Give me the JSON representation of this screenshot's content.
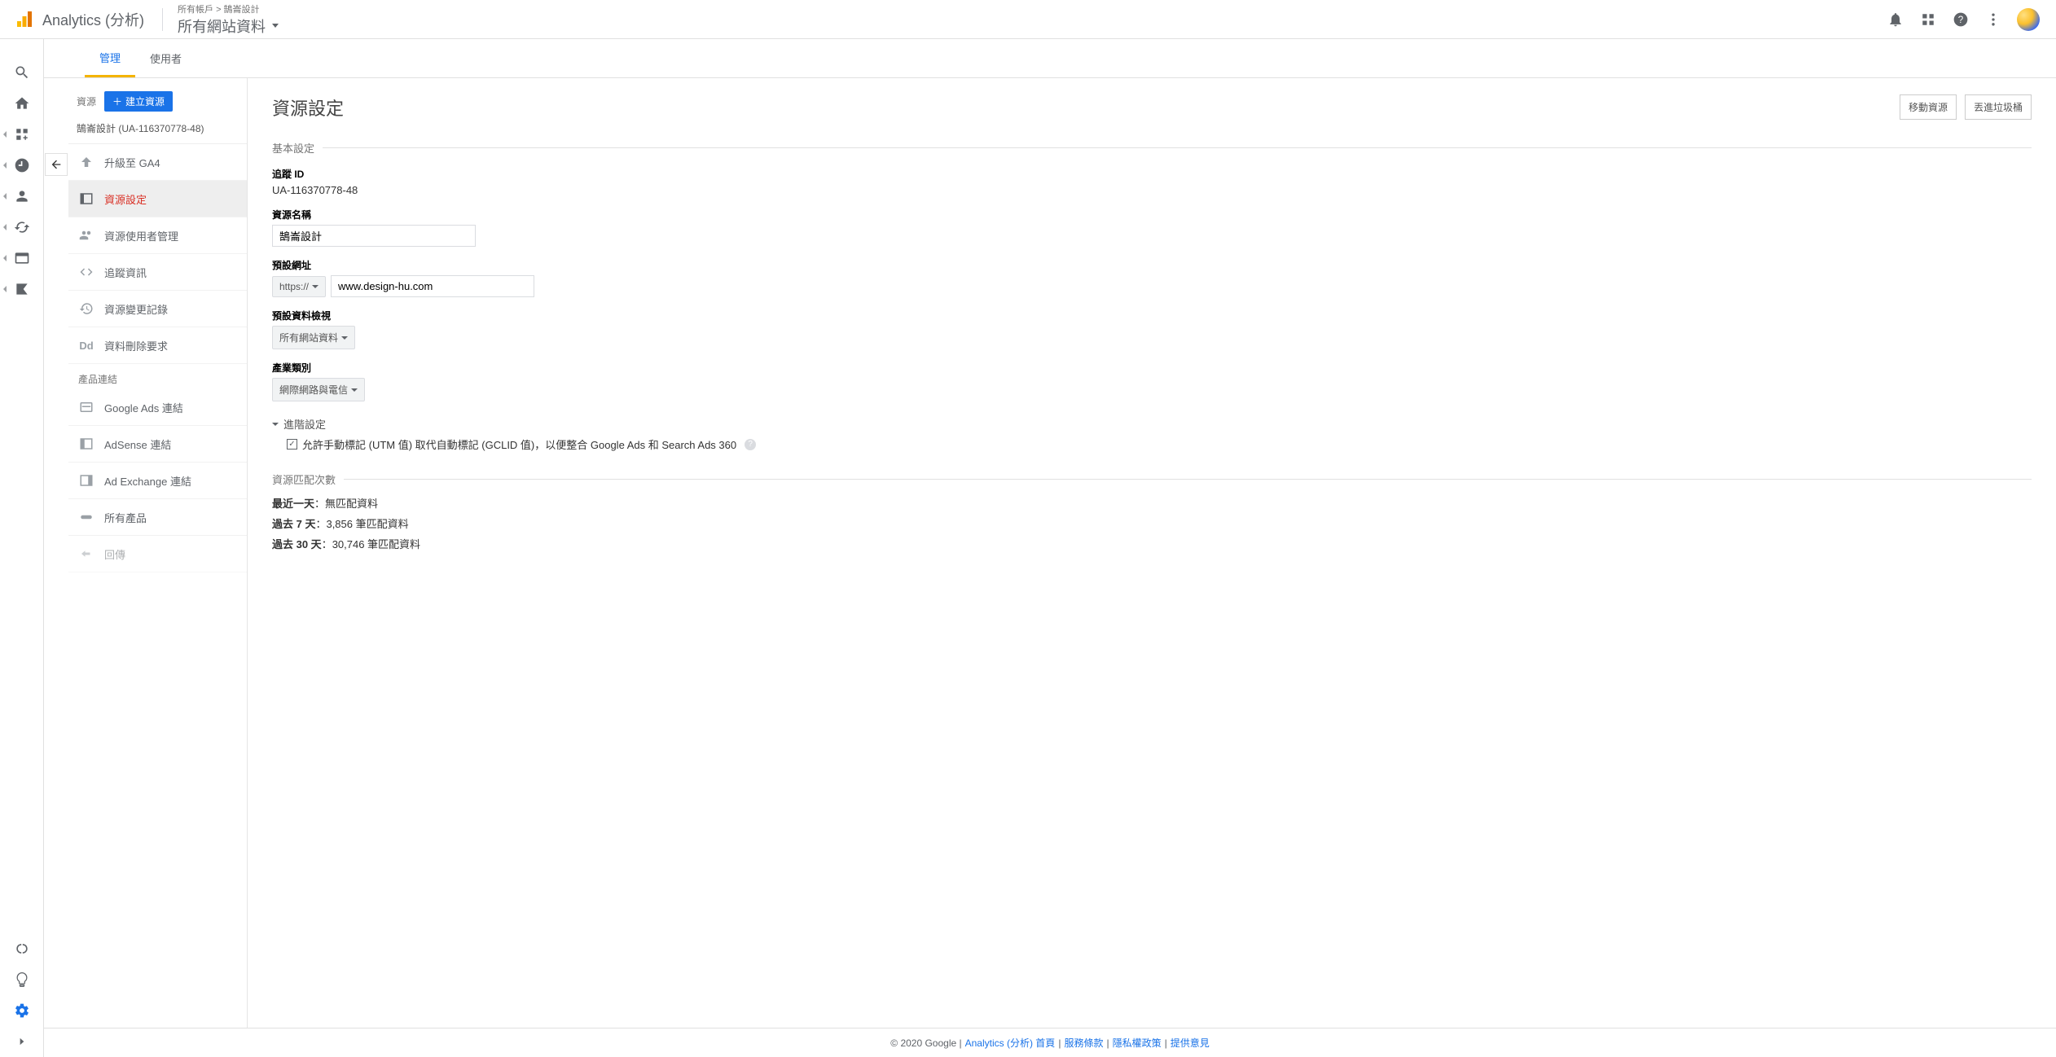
{
  "header": {
    "product": "Analytics (分析)",
    "crumb": "所有帳戶 > 鵠崙設計",
    "viewName": "所有網站資料"
  },
  "tabs": {
    "admin": "管理",
    "users": "使用者"
  },
  "midcol": {
    "label": "資源",
    "createBtn": "建立資源",
    "subtitle": "鵠崙設計 (UA-116370778-48)",
    "items": {
      "upgrade": "升級至 GA4",
      "settings": "資源設定",
      "usermgmt": "資源使用者管理",
      "tracking": "追蹤資訊",
      "changelog": "資源變更記錄",
      "deletereq": "資料刪除要求"
    },
    "groupLabel": "產品連結",
    "links": {
      "gads": "Google Ads 連結",
      "adsense": "AdSense 連結",
      "adx": "Ad Exchange 連結",
      "allproducts": "所有產品",
      "postback": "回傳"
    }
  },
  "form": {
    "title": "資源設定",
    "actions": {
      "move": "移動資源",
      "trash": "丟進垃圾桶"
    },
    "sectionBasic": "基本設定",
    "trackingIdLabel": "追蹤 ID",
    "trackingId": "UA-116370778-48",
    "nameLabel": "資源名稱",
    "nameValue": "鵠崙設計",
    "urlLabel": "預設網址",
    "urlProto": "https://",
    "urlValue": "www.design-hu.com",
    "defaultViewLabel": "預設資料檢視",
    "defaultView": "所有網站資料",
    "industryLabel": "產業類別",
    "industry": "網際網路與電信",
    "advLabel": "進階設定",
    "advCheck": "允許手動標記 (UTM 值) 取代自動標記 (GCLID 值)，以便整合 Google Ads 和 Search Ads 360",
    "hitsSection": "資源匹配次數",
    "hits1Label": "最近一天",
    "hits1Val": "：無匹配資料",
    "hits7Label": "過去 7 天",
    "hits7Val": "：3,856 筆匹配資料",
    "hits30Label": "過去 30 天",
    "hits30Val": "：30,746 筆匹配資料"
  },
  "footer": {
    "copy": "© 2020 Google | ",
    "home": "Analytics (分析) 首頁",
    "sep": " | ",
    "terms": "服務條款",
    "privacy": "隱私權政策",
    "feedback": "提供意見"
  }
}
